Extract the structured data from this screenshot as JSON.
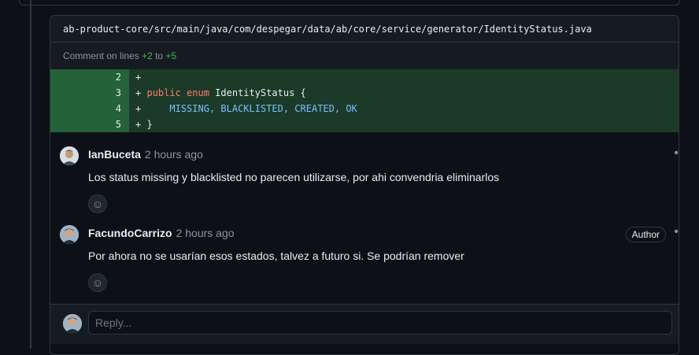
{
  "file": {
    "path": "ab-product-core/src/main/java/com/despegar/data/ab/core/service/generator/IdentityStatus.java"
  },
  "comment_on": {
    "prefix": "Comment on lines",
    "start": "+2",
    "to": "to",
    "end": "+5"
  },
  "diff": [
    {
      "num": "2",
      "sign": "+",
      "code": ""
    },
    {
      "num": "3",
      "sign": "+",
      "code": "public enum IdentityStatus {"
    },
    {
      "num": "4",
      "sign": "+",
      "code": "    MISSING, BLACKLISTED, CREATED, OK"
    },
    {
      "num": "5",
      "sign": "+",
      "code": "}"
    }
  ],
  "comments": [
    {
      "author": "IanBuceta",
      "time": "2 hours ago",
      "body": "Los status missing y blacklisted no parecen utilizarse, por ahi convendria eliminarlos",
      "badge": ""
    },
    {
      "author": "FacundoCarrizo",
      "time": "2 hours ago",
      "body": "Por ahora no se usarían esos estados, talvez a futuro si. Se podrían remover",
      "badge": "Author"
    }
  ],
  "reply": {
    "placeholder": "Reply..."
  },
  "icons": {
    "kebab": "kebab-horizontal-icon",
    "emoji": "smiley-icon"
  },
  "colors": {
    "bg": "#0d1117",
    "added_line": "#1b3a27",
    "line_number_added": "#24623a",
    "keyword": "#ff7b72",
    "constant": "#79c0ff"
  }
}
